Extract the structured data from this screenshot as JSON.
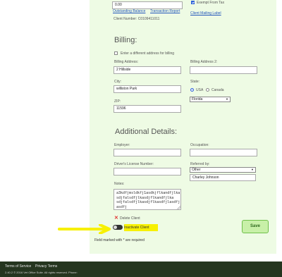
{
  "top": {
    "balance_value": "0.00",
    "outstanding_balance_link": "Outstanding Balance",
    "transaction_report_link": "Transaction Report",
    "exempt_from_tax_label": "Exempt From Tax",
    "client_mailing_label_link": "Client Mailing Label",
    "client_number": "Client Number: C0109411011"
  },
  "billing": {
    "title": "Billing:",
    "different_address_label": "Enter a different address for billing",
    "address_label": "Billing Address:",
    "address_value": "2 Hillside",
    "address2_label": "Billing Address 2:",
    "address2_value": "",
    "city_label": "City:",
    "city_value": "williston Park",
    "state_label": "State:",
    "country_usa": "USA",
    "country_canada": "Canada",
    "state_value": "Florida",
    "zip_label": "ZIP:",
    "zip_value": "11596"
  },
  "additional": {
    "title": "Additional Details:",
    "employer_label": "Employer:",
    "employer_value": "",
    "occupation_label": "Occupation:",
    "occupation_value": "",
    "license_label": "Driver's License Number:",
    "license_value": "",
    "referred_label": "Referred by:",
    "referred_value": "Other",
    "referred_name": "Charley Johnson",
    "notes_label": "Notes:",
    "notes_value": "a3kdfjmsldkfj1asdkjflkandfjlka\nsdjfalsdfjlkasdjflkandfjlka\nsdjfalsdfjlkasdjflkasdfjlasdfj\nasdfj"
  },
  "actions": {
    "delete_label": "Delete Client",
    "inactivate_label": "Inactivate Client",
    "required_note": "Field marked with * are required",
    "save_label": "Save"
  },
  "footer": {
    "terms": "Terms of Service",
    "privacy": "Privacy Terms",
    "copyright": "2.40.2 © 2016 Vet Office Suite. All rights reserved. Phone:"
  },
  "colors": {
    "panel_bg": "#eefbe4",
    "highlight": "#f7f000",
    "footer_bg": "#25351f",
    "save_button": "#c8f0a8",
    "delete_icon": "#e03030"
  },
  "icons": [
    "delete-x-icon",
    "toggle-switch-icon",
    "caret-down-icon",
    "resize-grip-icon",
    "highlight-arrow-icon"
  ]
}
